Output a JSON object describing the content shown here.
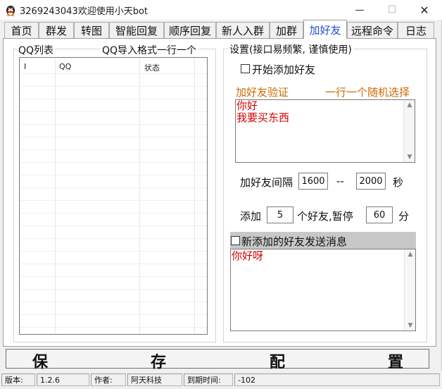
{
  "window": {
    "title": "3269243043欢迎使用小天bot",
    "minimize": "—",
    "maximize": "☐",
    "close": "✕"
  },
  "tabs": [
    {
      "label": "首页"
    },
    {
      "label": "群发"
    },
    {
      "label": "转图"
    },
    {
      "label": "智能回复"
    },
    {
      "label": "顺序回复"
    },
    {
      "label": "新人入群"
    },
    {
      "label": "加群"
    },
    {
      "label": "加好友",
      "active": true
    },
    {
      "label": "远程命令"
    },
    {
      "label": "日志"
    }
  ],
  "qq_list": {
    "title": "QQ列表",
    "hint": "QQ导入格式一行一个",
    "columns": [
      "I",
      "QQ",
      "状态"
    ]
  },
  "settings": {
    "title": "设置(接口易频繁, 谨慎使用)",
    "start_add_label": "开始添加好友",
    "start_add_checked": false,
    "verify_label": "加好友验证",
    "verify_hint": "一行一个随机选择",
    "verify_messages": [
      "你好",
      "我要买东西"
    ],
    "interval_label": "加好友间隔",
    "interval_min": "1600",
    "interval_sep": "--",
    "interval_max": "2000",
    "interval_unit": "秒",
    "add_label": "添加",
    "add_count": "5",
    "pause_label": "个好友,暂停",
    "pause_value": "60",
    "pause_unit": "分",
    "send_msg_label": "新添加的好友发送消息",
    "send_msg_checked": false,
    "send_message": "你好呀"
  },
  "save_button": {
    "chars": [
      "保",
      "存",
      "配",
      "置"
    ]
  },
  "status_bar": {
    "version_label": "版本:",
    "version_value": "1.2.6",
    "author_label": "作者:",
    "author_value": "阿天科技",
    "expire_label": "到期时间:",
    "expire_value": "-102"
  },
  "colors": {
    "active_tab_text": "#1f4fcf",
    "orange_label": "#cc6a00",
    "message_red": "#d40000"
  }
}
